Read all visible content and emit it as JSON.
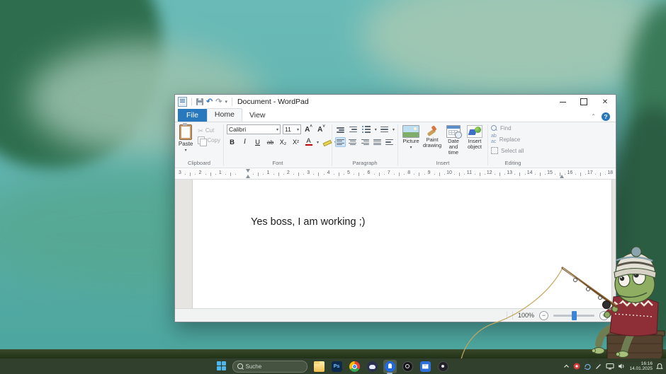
{
  "colors": {
    "file_tab_blue": "#2878be",
    "selection_blue": "#cfe4f7",
    "taskbar_green": "#313d28",
    "slider_thumb_blue": "#3b85d8",
    "fishing_line": "#c2a85e",
    "font_color_red": "#c00000"
  },
  "window": {
    "title": "Document - WordPad",
    "tabs": [
      {
        "label": "File"
      },
      {
        "label": "Home"
      },
      {
        "label": "View"
      }
    ],
    "ribbon": {
      "clipboard": {
        "label": "Clipboard",
        "paste": "Paste",
        "cut": "Cut",
        "copy": "Copy"
      },
      "font": {
        "label": "Font",
        "family": "Calibri",
        "size": "11",
        "bold": "B",
        "italic": "I",
        "underline": "U",
        "strike": "ab",
        "subscript": "X₂",
        "superscript": "X²",
        "color_letter": "A"
      },
      "paragraph": {
        "label": "Paragraph"
      },
      "insert": {
        "label": "Insert",
        "items": [
          "Picture",
          "Paint drawing",
          "Date and time",
          "Insert object"
        ]
      },
      "editing": {
        "label": "Editing",
        "items": [
          "Find",
          "Replace",
          "Select all"
        ]
      }
    },
    "ruler": {
      "left": [
        "3",
        "2",
        "1"
      ],
      "right": [
        "1",
        "2",
        "3",
        "4",
        "5",
        "6",
        "7",
        "8",
        "9",
        "10",
        "11",
        "12",
        "13",
        "14",
        "15",
        "16",
        "17",
        "18"
      ]
    },
    "document_text": "Yes boss, I am working ;)",
    "statusbar": {
      "zoom": "100%"
    }
  },
  "taskbar": {
    "search_placeholder": "Suche",
    "apps": [
      {
        "name": "file-explorer",
        "text": "",
        "active": false
      },
      {
        "name": "photoshop",
        "text": "Ps",
        "active": false
      },
      {
        "name": "chrome",
        "text": "",
        "active": false
      },
      {
        "name": "discord",
        "text": "",
        "active": false
      },
      {
        "name": "app-lightbulb",
        "text": "",
        "active": true
      },
      {
        "name": "obs",
        "text": "",
        "active": false
      },
      {
        "name": "mail",
        "text": "",
        "active": false
      },
      {
        "name": "app-dark",
        "text": "",
        "active": false
      }
    ],
    "clock": {
      "time": "16:16",
      "date": "14.01.2025"
    }
  }
}
